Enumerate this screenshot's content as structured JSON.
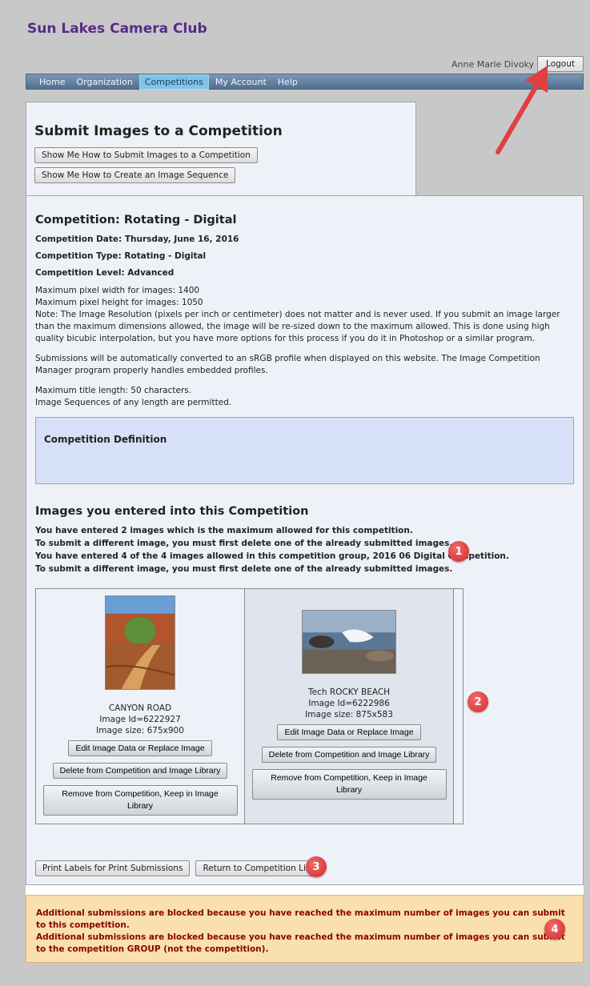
{
  "site": {
    "title": "Sun Lakes Camera Club"
  },
  "user": {
    "name": "Anne Marie Divoky",
    "logout_label": "Logout"
  },
  "nav": {
    "items": [
      {
        "label": "Home"
      },
      {
        "label": "Organization"
      },
      {
        "label": "Competitions",
        "active": true
      },
      {
        "label": "My Account"
      },
      {
        "label": "Help"
      }
    ]
  },
  "submit": {
    "title": "Submit Images to a Competition",
    "help_btn_1": "Show Me How to Submit Images to a Competition",
    "help_btn_2": "Show Me How to Create an Image Sequence"
  },
  "competition": {
    "title": "Competition: Rotating - Digital",
    "date": "Competition Date: Thursday, June 16, 2016",
    "type": "Competition Type: Rotating - Digital",
    "level": "Competition Level: Advanced",
    "max_width": "Maximum pixel width for images: 1400",
    "max_height": "Maximum pixel height for images: 1050",
    "note": "Note: The Image Resolution (pixels per inch or centimeter) does not matter and is never used. If you submit an image larger than the maximum dimensions allowed, the image will be re-sized down to the maximum allowed. This is done using high quality bicubic interpolation, but you have more options for this process if you do it in Photoshop or a similar program.",
    "srgb_note": "Submissions will be automatically converted to an sRGB profile when displayed on this website. The Image Competition Manager program properly handles embedded profiles.",
    "max_title": "Maximum title length: 50 characters.",
    "sequences": "Image Sequences of any length are permitted.",
    "definition_title": "Competition Definition"
  },
  "entries": {
    "title": "Images you entered into this Competition",
    "notice_1": "You have entered 2 images which is the maximum allowed for this competition.",
    "notice_2": "To submit a different image, you must first delete one of the already submitted images.",
    "notice_3": "You have entered 4 of the 4 images allowed in this competition group, 2016 06 Digital Competition.",
    "notice_4": "To submit a different image, you must first delete one of the already submitted images.",
    "images": [
      {
        "title": "CANYON ROAD",
        "id": "Image Id=6222927",
        "size": "Image size: 675x900"
      },
      {
        "title": "Tech ROCKY BEACH",
        "id": "Image Id=6222986",
        "size": "Image size: 875x583"
      }
    ],
    "edit_label": "Edit Image Data or Replace Image",
    "delete_label": "Delete from Competition and Image Library",
    "remove_label": "Remove from Competition, Keep in Image Library"
  },
  "actions": {
    "print_labels": "Print Labels for Print Submissions",
    "return_list": "Return to Competition List"
  },
  "warnings": {
    "line_1": "Additional submissions are blocked because you have reached the maximum number of images you can submit to this competition.",
    "line_2": "Additional submissions are blocked because you have reached the maximum number of images you can submit to the competition GROUP (not the competition)."
  },
  "annotations": {
    "badge_1": "1",
    "badge_2": "2",
    "badge_3": "3",
    "badge_4": "4"
  },
  "colors": {
    "accent": "#5a2a86",
    "nav": "#5f7fa1",
    "warning_text": "#8b0000",
    "badge": "#d93636"
  }
}
